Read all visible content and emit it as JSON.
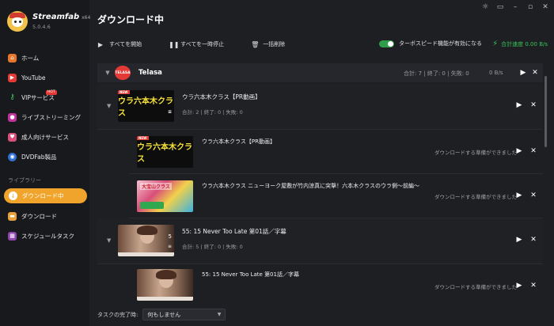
{
  "app": {
    "name": "Streamfab",
    "arch": "x64",
    "version": "5.0.4.6"
  },
  "window_controls": [
    "☼",
    "▭",
    "–",
    "▫",
    "✕"
  ],
  "sidebar": {
    "items": [
      {
        "label": "ホーム",
        "icon": "home-icon"
      },
      {
        "label": "YouTube",
        "icon": "youtube-icon"
      },
      {
        "label": "VIPサービス",
        "icon": "key-icon",
        "badge": "HOT"
      },
      {
        "label": "ライブストリーミング",
        "icon": "live-icon"
      },
      {
        "label": "成人向けサービス",
        "icon": "adult-icon"
      },
      {
        "label": "DVDFab製品",
        "icon": "dvdfab-icon"
      }
    ],
    "section_label": "ライブラリー",
    "library_items": [
      {
        "label": "ダウンロード中",
        "icon": "download-icon",
        "active": true
      },
      {
        "label": "ダウンロード",
        "icon": "folder-icon"
      },
      {
        "label": "スケジュールタスク",
        "icon": "schedule-icon"
      }
    ]
  },
  "header": {
    "title": "ダウンロード中"
  },
  "toolbar": {
    "start_all": "すべてを開始",
    "pause_all": "すべてを一時停止",
    "delete_all": "一括削除",
    "turbo_label": "ターボスピード機能が有効になる",
    "turbo_on": true,
    "total_speed": "合計速度 0.00 B/s"
  },
  "service": {
    "logo_text": "TELASA",
    "name": "Telasa",
    "stats": "合計: 7 | 終了: 0 | 失敗: 0",
    "speed": "0 B/s"
  },
  "groups": [
    {
      "title": "ウラ六本木クラス【PR動画】",
      "stats": "合計: 2 | 終了: 0 | 失敗: 0",
      "thumb_text": "ウラ六本木クラス",
      "items": [
        {
          "title": "ウラ六本木クラス【PR動画】",
          "status": "ダウンロードする準備ができました",
          "thumb_text": "ウラ六本木クラス"
        },
        {
          "title": "ウラ六本木クラス ニューヨーク屋敷が竹内涼真に突撃！六本木クラスのウラ側～前編～",
          "status": "ダウンロードする準備ができました",
          "thumb_text": "大宝山クラス"
        }
      ]
    },
    {
      "title": "55: 15 Never Too Late 第01話／字幕",
      "stats": "合計: 5 | 終了: 0 | 失敗: 0",
      "count": "5",
      "items": [
        {
          "title": "55: 15 Never Too Late 第01話／字幕",
          "status": "ダウンロードする準備ができました"
        }
      ]
    }
  ],
  "footer": {
    "label": "タスクの完了時:",
    "selected": "何もしません"
  },
  "colors": {
    "accent": "#f0a42b",
    "speed_green": "#37c25a",
    "toggle_on": "#2e9e4a"
  }
}
